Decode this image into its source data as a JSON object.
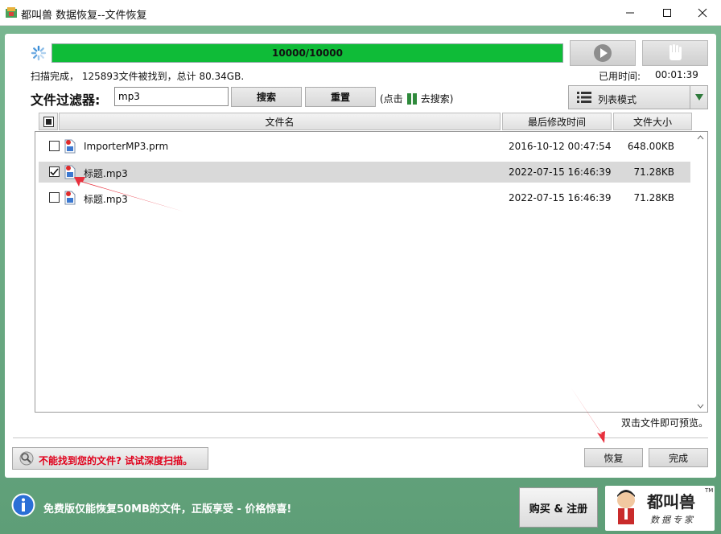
{
  "window": {
    "title": "都叫兽 数据恢复--文件恢复"
  },
  "progress": {
    "text": "10000/10000",
    "value": 1.0
  },
  "status": {
    "summary": "扫描完成， 125893文件被找到，总计 80.34GB.",
    "elapsed_label": "已用时间:",
    "elapsed_value": "00:01:39"
  },
  "filter": {
    "label": "文件过滤器:",
    "value": "mp3",
    "search_button": "搜索",
    "reset_button": "重置",
    "hint_prefix": "(点击",
    "hint_suffix": "去搜索)"
  },
  "view_mode": {
    "label": "列表模式"
  },
  "table": {
    "columns": [
      "文件名",
      "最后修改时间",
      "文件大小"
    ],
    "rows": [
      {
        "checked": false,
        "name": "ImporterMP3.prm",
        "modified": "2016-10-12 00:47:54",
        "size": "648.00KB"
      },
      {
        "checked": true,
        "name": "标题.mp3",
        "modified": "2022-07-15 16:46:39",
        "size": "71.28KB"
      },
      {
        "checked": false,
        "name": "标题.mp3",
        "modified": "2022-07-15 16:46:39",
        "size": "71.28KB"
      }
    ]
  },
  "preview_hint": "双击文件即可预览。",
  "deep_scan": "不能找到您的文件? 试试深度扫描。",
  "actions": {
    "recover": "恢复",
    "done": "完成"
  },
  "banner": {
    "text": "免费版仅能恢复50MB的文件，正版享受 - 价格惊喜!",
    "buy": "购买 & 注册"
  },
  "brand": {
    "name": "都叫兽",
    "tagline": "数据专家",
    "tm": "TM"
  },
  "colors": {
    "progress": "#0fbc38",
    "frame": "#6fae86",
    "warning_text": "#e0001b",
    "arrow": "#e8303d"
  }
}
